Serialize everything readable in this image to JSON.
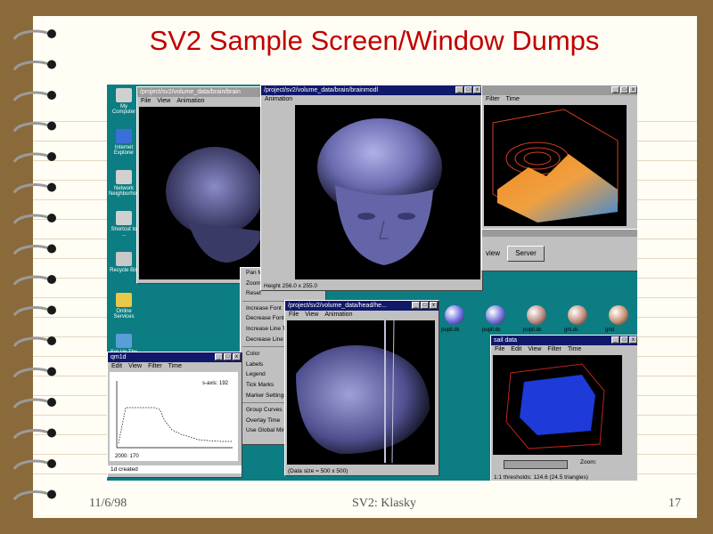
{
  "slide": {
    "title": "SV2 Sample Screen/Window Dumps",
    "date": "11/6/98",
    "author": "SV2: Klasky",
    "page_number": "17"
  },
  "desktop_icons": [
    {
      "label": "My Computer",
      "icon": "computer-icon",
      "color": "#d0d0d0"
    },
    {
      "label": "Internet Explorer",
      "icon": "ie-icon",
      "color": "#3a6fd8"
    },
    {
      "label": "Network Neighborhood",
      "icon": "network-icon",
      "color": "#d0d0d0"
    },
    {
      "label": "Shortcut to ...",
      "icon": "shortcut-icon",
      "color": "#d0d0d0"
    },
    {
      "label": "Recycle Bin",
      "icon": "recycle-bin-icon",
      "color": "#c8c8c8"
    },
    {
      "label": "Online Services",
      "icon": "folder-icon",
      "color": "#e8c84a"
    },
    {
      "label": "Set Up The Microsoft Network",
      "icon": "msn-icon",
      "color": "#5a9ed8"
    }
  ],
  "windows": {
    "brain_small": {
      "title": "/project/sv2/volume_data/brain/brain",
      "menu": [
        "File",
        "View",
        "Animation"
      ]
    },
    "brain_large": {
      "title": "/project/sv2/volume_data/brain/brainmodl",
      "menu": [
        "Animation"
      ],
      "status": "Height 256.0 x 255.0"
    },
    "surface": {
      "title": "",
      "menu": [
        "Filter",
        "Time"
      ]
    },
    "head": {
      "title": "/project/sv2/volume_data/head/he...",
      "menu": [
        "File",
        "View",
        "Animation"
      ],
      "status": "(Data size = 500 x 500)"
    },
    "plot1d": {
      "title": "qm1d",
      "menu": [
        "Edit",
        "View",
        "Filter",
        "Time"
      ],
      "legend": "s-axis: 192",
      "xlabel": "2000: 170",
      "status": "1d created"
    },
    "vol3d": {
      "title": "sail data",
      "menu": [
        "File",
        "Edit",
        "View",
        "Filter",
        "Time"
      ],
      "zoom_label": "Zoom:",
      "status": "1:1 thresholds: 124.6 (24.5 triangles)"
    },
    "toolbar": {
      "view_label": "view",
      "server_label": "Server"
    }
  },
  "context_menu": [
    {
      "label": "Pan Mode",
      "submenu": false
    },
    {
      "label": "Zoom Mode",
      "submenu": false
    },
    {
      "label": "Reset",
      "submenu": false
    },
    {
      "sep": true
    },
    {
      "label": "Increase Font",
      "submenu": false
    },
    {
      "label": "Decrease Font",
      "submenu": false
    },
    {
      "label": "Increase Line Thickness",
      "submenu": false
    },
    {
      "label": "Decrease Line Thickness",
      "submenu": false
    },
    {
      "sep": true
    },
    {
      "label": "Color",
      "submenu": true
    },
    {
      "label": "Labels",
      "submenu": true
    },
    {
      "label": "Legend",
      "submenu": true
    },
    {
      "label": "Tick Marks",
      "submenu": true
    },
    {
      "label": "Marker Settings...",
      "submenu": false
    },
    {
      "sep": true
    },
    {
      "label": "Group Curves",
      "submenu": false
    },
    {
      "label": "Overlay Time",
      "submenu": false
    },
    {
      "label": "Use Global Minmax",
      "submenu": false
    }
  ],
  "thumbnails": [
    {
      "label": "pupil.dc",
      "color": "#6a6ae0"
    },
    {
      "label": "pupil.dc",
      "color": "#7070d8"
    },
    {
      "label": "pupil.dc",
      "color": "#b88a80"
    },
    {
      "label": "gnl.dc",
      "color": "#c08a78"
    },
    {
      "label": "grid",
      "color": "#c89070"
    }
  ],
  "colors": {
    "desktop": "#0c7d82",
    "title_red": "#c00000",
    "active_title": "#10186a"
  }
}
